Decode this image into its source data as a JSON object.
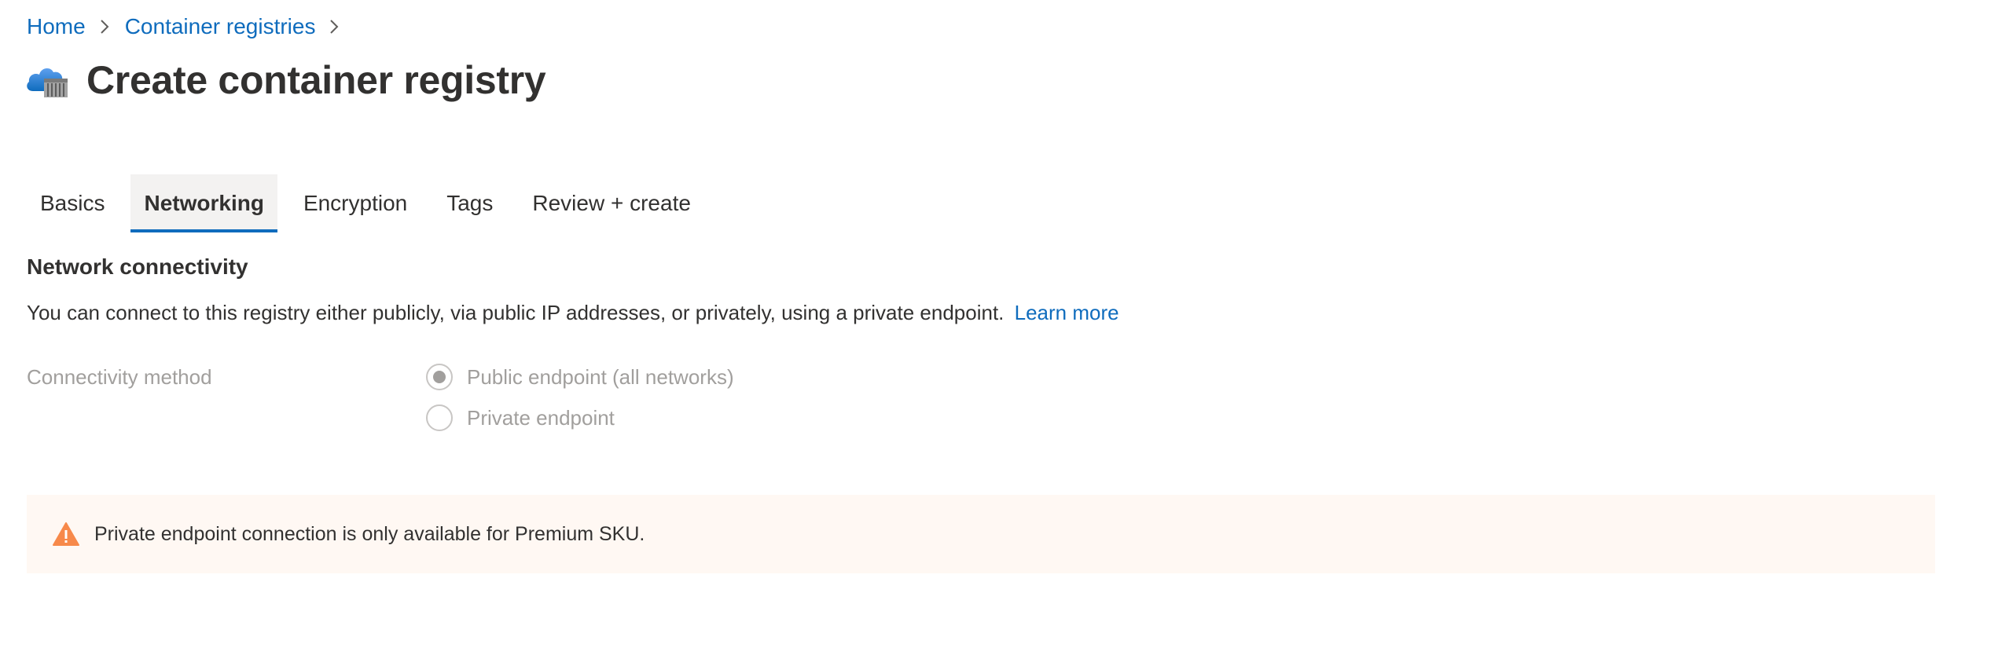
{
  "breadcrumb": {
    "items": [
      {
        "label": "Home"
      },
      {
        "label": "Container registries"
      }
    ]
  },
  "header": {
    "title": "Create container registry",
    "icon": "container-registry-icon"
  },
  "tabs": [
    {
      "label": "Basics",
      "active": false
    },
    {
      "label": "Networking",
      "active": true
    },
    {
      "label": "Encryption",
      "active": false
    },
    {
      "label": "Tags",
      "active": false
    },
    {
      "label": "Review + create",
      "active": false
    }
  ],
  "network": {
    "heading": "Network connectivity",
    "description": "You can connect to this registry either publicly, via public IP addresses, or privately, using a private endpoint.",
    "learn_more": "Learn more",
    "connectivity_label": "Connectivity method",
    "options": [
      {
        "label": "Public endpoint (all networks)",
        "selected": true,
        "disabled": true
      },
      {
        "label": "Private endpoint",
        "selected": false,
        "disabled": true
      }
    ]
  },
  "warning": {
    "icon": "warning-triangle-icon",
    "text": "Private endpoint connection is only available for Premium SKU."
  },
  "colors": {
    "link": "#0f6cbd",
    "tab_underline": "#0f6cbd",
    "warning_bg": "#fff8f3",
    "warning_icon": "#f7894a",
    "disabled_text": "#a19f9d"
  }
}
